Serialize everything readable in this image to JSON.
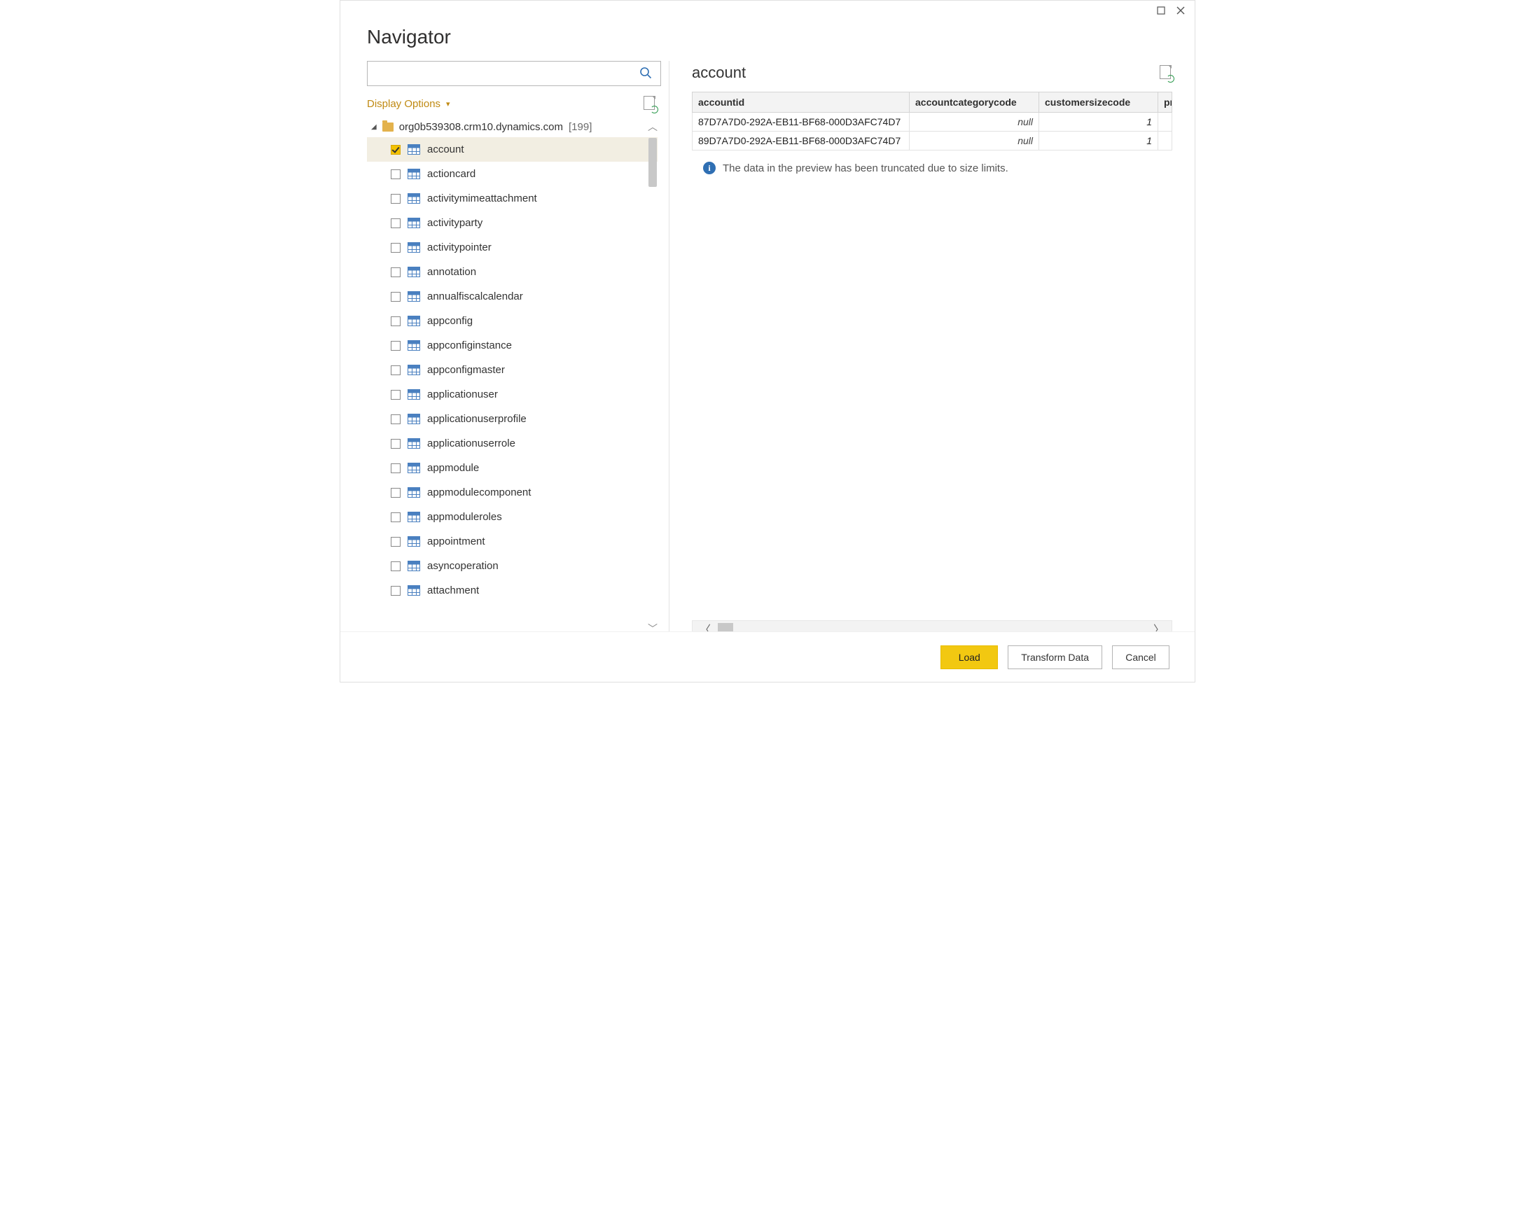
{
  "window": {
    "title": "Navigator"
  },
  "search": {
    "value": "",
    "placeholder": ""
  },
  "display_options": {
    "label": "Display Options"
  },
  "tree": {
    "root_label": "org0b539308.crm10.dynamics.com",
    "root_count": "[199]",
    "items": [
      {
        "label": "account",
        "checked": true,
        "selected": true
      },
      {
        "label": "actioncard",
        "checked": false,
        "selected": false
      },
      {
        "label": "activitymimeattachment",
        "checked": false,
        "selected": false
      },
      {
        "label": "activityparty",
        "checked": false,
        "selected": false
      },
      {
        "label": "activitypointer",
        "checked": false,
        "selected": false
      },
      {
        "label": "annotation",
        "checked": false,
        "selected": false
      },
      {
        "label": "annualfiscalcalendar",
        "checked": false,
        "selected": false
      },
      {
        "label": "appconfig",
        "checked": false,
        "selected": false
      },
      {
        "label": "appconfiginstance",
        "checked": false,
        "selected": false
      },
      {
        "label": "appconfigmaster",
        "checked": false,
        "selected": false
      },
      {
        "label": "applicationuser",
        "checked": false,
        "selected": false
      },
      {
        "label": "applicationuserprofile",
        "checked": false,
        "selected": false
      },
      {
        "label": "applicationuserrole",
        "checked": false,
        "selected": false
      },
      {
        "label": "appmodule",
        "checked": false,
        "selected": false
      },
      {
        "label": "appmodulecomponent",
        "checked": false,
        "selected": false
      },
      {
        "label": "appmoduleroles",
        "checked": false,
        "selected": false
      },
      {
        "label": "appointment",
        "checked": false,
        "selected": false
      },
      {
        "label": "asyncoperation",
        "checked": false,
        "selected": false
      },
      {
        "label": "attachment",
        "checked": false,
        "selected": false
      }
    ]
  },
  "preview": {
    "title": "account",
    "columns": [
      "accountid",
      "accountcategorycode",
      "customersizecode",
      "pr"
    ],
    "rows": [
      {
        "accountid": "87D7A7D0-292A-EB11-BF68-000D3AFC74D7",
        "accountcategorycode": "null",
        "customersizecode": "1"
      },
      {
        "accountid": "89D7A7D0-292A-EB11-BF68-000D3AFC74D7",
        "accountcategorycode": "null",
        "customersizecode": "1"
      }
    ],
    "info": "The data in the preview has been truncated due to size limits."
  },
  "footer": {
    "load": "Load",
    "transform": "Transform Data",
    "cancel": "Cancel"
  }
}
